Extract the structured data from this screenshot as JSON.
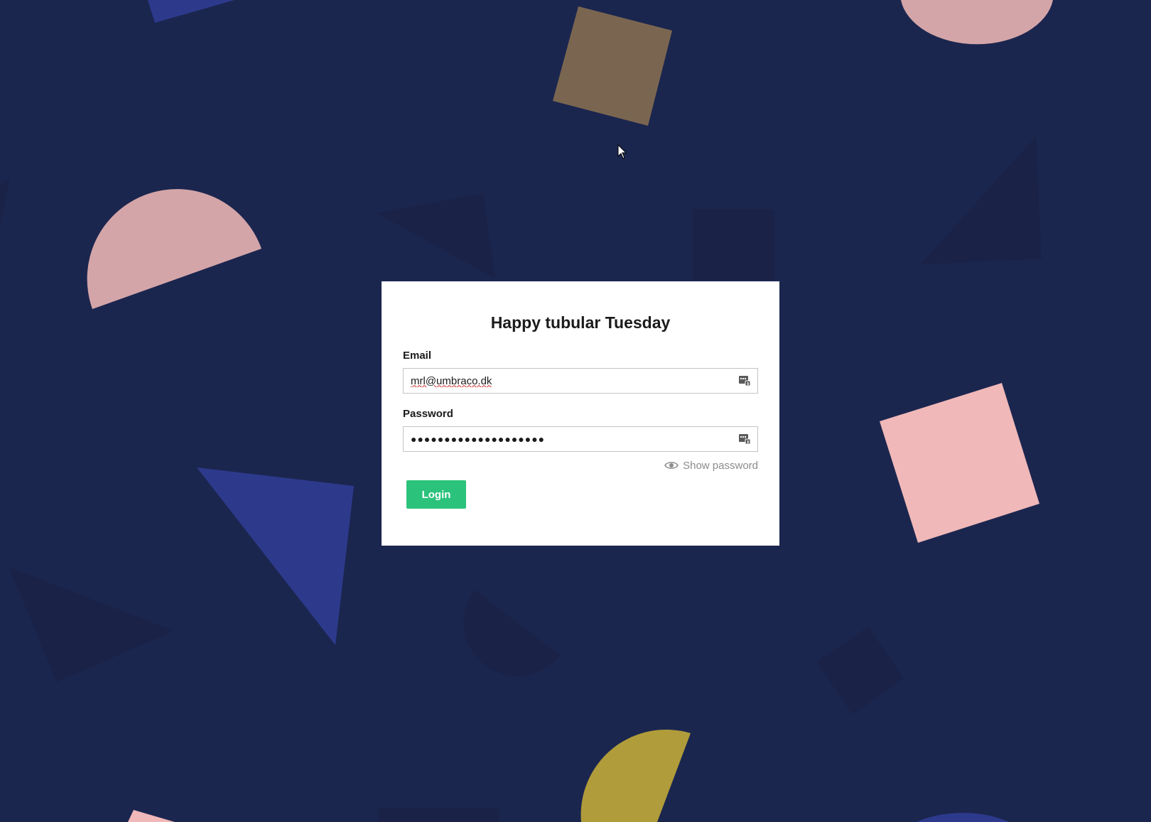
{
  "page": {
    "background_color": "#1b264f"
  },
  "login": {
    "greeting": "Happy tubular Tuesday",
    "email_label": "Email",
    "email_value": "mrl@umbraco.dk",
    "password_label": "Password",
    "password_value": "●●●●●●●●●●●●●●●●●●●●",
    "show_password_label": "Show password",
    "login_button_label": "Login"
  },
  "colors": {
    "button": "#2bc37c",
    "card": "#ffffff",
    "label": "#1b1b1b",
    "muted": "#8b8b8b",
    "shape_pink": "#d4a5a8",
    "shape_salmon": "#f0b8b8",
    "shape_brown": "#7a6650",
    "shape_blue": "#2d3a8c",
    "shape_mustard": "#b09c3a",
    "shape_dark": "#1a2247"
  },
  "icons": {
    "autofill": "autofill-key-icon",
    "eye": "eye-icon",
    "cursor": "mouse-pointer-icon"
  }
}
